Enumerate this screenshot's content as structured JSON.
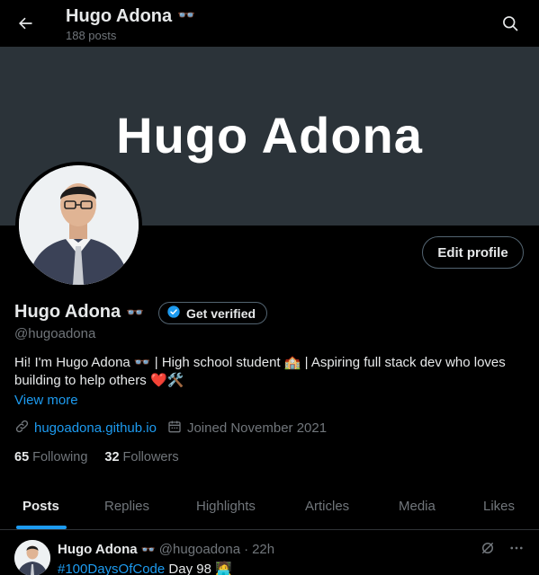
{
  "header": {
    "name": "Hugo Adona",
    "name_emoji": "👓",
    "posts_count": "188 posts"
  },
  "banner": {
    "text": "Hugo Adona"
  },
  "profile": {
    "name": "Hugo Adona",
    "name_emoji": "👓",
    "verify_label": "Get verified",
    "edit_label": "Edit profile",
    "handle": "@hugoadona",
    "bio_line1": "Hi! I'm Hugo Adona 👓 | High school student 🏫 | Aspiring full stack dev who loves",
    "bio_line2": "building to help others ❤️🛠️",
    "view_more": "View more",
    "website": "hugoadona.github.io",
    "joined": "Joined November 2021",
    "following_count": "65",
    "following_label": "Following",
    "followers_count": "32",
    "followers_label": "Followers"
  },
  "tabs": [
    "Posts",
    "Replies",
    "Highlights",
    "Articles",
    "Media",
    "Likes"
  ],
  "post": {
    "author": "Hugo Adona",
    "author_emoji": "👓",
    "handle": "@hugoadona",
    "separator": "·",
    "time": "22h",
    "hashtag": "#100DaysOfCode",
    "text": " Day 98 🧑‍💻"
  },
  "colors": {
    "accent": "#1d9bf0",
    "banner_bg": "#2b3339",
    "muted": "#71767b"
  }
}
